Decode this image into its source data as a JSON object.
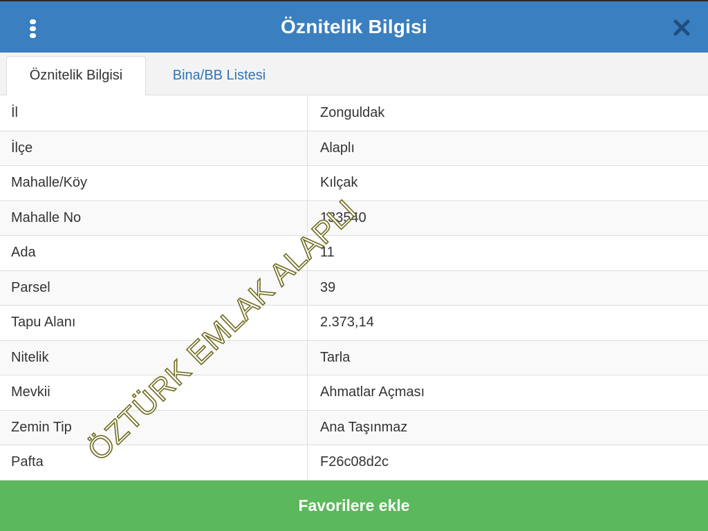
{
  "header": {
    "title": "Öznitelik Bilgisi",
    "menu_icon": "vertical-ellipsis-icon",
    "close_icon": "close-icon"
  },
  "tabs": [
    {
      "label": "Öznitelik Bilgisi",
      "active": true
    },
    {
      "label": "Bina/BB Listesi",
      "active": false
    }
  ],
  "attributes": [
    {
      "label": "İl",
      "value": "Zonguldak"
    },
    {
      "label": "İlçe",
      "value": "Alaplı"
    },
    {
      "label": "Mahalle/Köy",
      "value": "Kılçak"
    },
    {
      "label": "Mahalle No",
      "value": "133540"
    },
    {
      "label": "Ada",
      "value": "11"
    },
    {
      "label": "Parsel",
      "value": "39"
    },
    {
      "label": "Tapu Alanı",
      "value": "2.373,14"
    },
    {
      "label": "Nitelik",
      "value": "Tarla"
    },
    {
      "label": "Mevkii",
      "value": "Ahmatlar Açması"
    },
    {
      "label": "Zemin Tip",
      "value": "Ana Taşınmaz"
    },
    {
      "label": "Pafta",
      "value": "F26c08d2c"
    }
  ],
  "watermark": "ÖZTÜRK EMLAK ALAPLI",
  "footer": {
    "button_label": "Favorilere ekle"
  },
  "colors": {
    "header_bg": "#3a7fc0",
    "tab_link": "#2f74b5",
    "button_bg": "#5cb85c"
  }
}
